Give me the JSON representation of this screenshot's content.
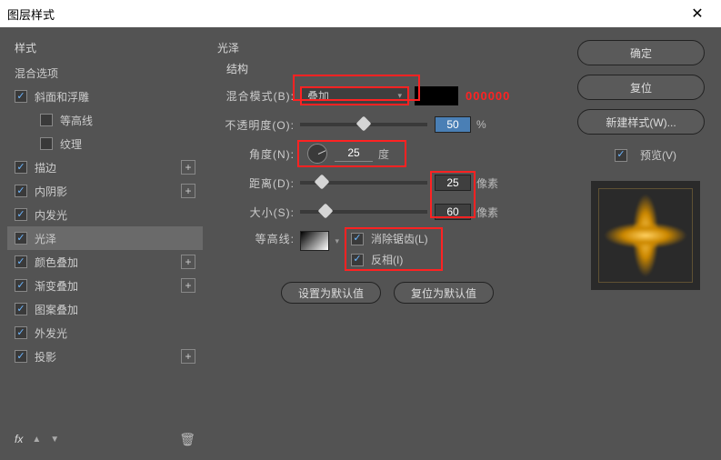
{
  "titlebar": {
    "title": "图层样式"
  },
  "left": {
    "header": "样式",
    "blendOptions": "混合选项",
    "items": [
      {
        "label": "斜面和浮雕",
        "checked": true,
        "plus": false,
        "sub": false
      },
      {
        "label": "等高线",
        "checked": false,
        "plus": false,
        "sub": true
      },
      {
        "label": "纹理",
        "checked": false,
        "plus": false,
        "sub": true
      },
      {
        "label": "描边",
        "checked": true,
        "plus": true,
        "sub": false
      },
      {
        "label": "内阴影",
        "checked": true,
        "plus": true,
        "sub": false
      },
      {
        "label": "内发光",
        "checked": true,
        "plus": false,
        "sub": false
      },
      {
        "label": "光泽",
        "checked": true,
        "plus": false,
        "sub": false,
        "selected": true
      },
      {
        "label": "颜色叠加",
        "checked": true,
        "plus": true,
        "sub": false
      },
      {
        "label": "渐变叠加",
        "checked": true,
        "plus": true,
        "sub": false
      },
      {
        "label": "图案叠加",
        "checked": true,
        "plus": false,
        "sub": false
      },
      {
        "label": "外发光",
        "checked": true,
        "plus": false,
        "sub": false
      },
      {
        "label": "投影",
        "checked": true,
        "plus": true,
        "sub": false
      }
    ],
    "footer": {
      "fx": "fx"
    }
  },
  "middle": {
    "sectionTitle": "光泽",
    "subTitle": "结构",
    "blendMode": {
      "label": "混合模式(B):",
      "value": "叠加",
      "hex": "000000"
    },
    "opacity": {
      "label": "不透明度(O):",
      "value": "50",
      "unit": "%"
    },
    "angle": {
      "label": "角度(N):",
      "value": "25",
      "unit": "度"
    },
    "distance": {
      "label": "距离(D):",
      "value": "25",
      "unit": "像素"
    },
    "size": {
      "label": "大小(S):",
      "value": "60",
      "unit": "像素"
    },
    "contour": {
      "label": "等高线:"
    },
    "antialias": {
      "label": "消除锯齿(L)",
      "checked": true
    },
    "invert": {
      "label": "反相(I)",
      "checked": true
    },
    "buttons": {
      "default": "设置为默认值",
      "reset": "复位为默认值"
    }
  },
  "right": {
    "ok": "确定",
    "cancel": "复位",
    "newStyle": "新建样式(W)...",
    "preview": "预览(V)"
  }
}
